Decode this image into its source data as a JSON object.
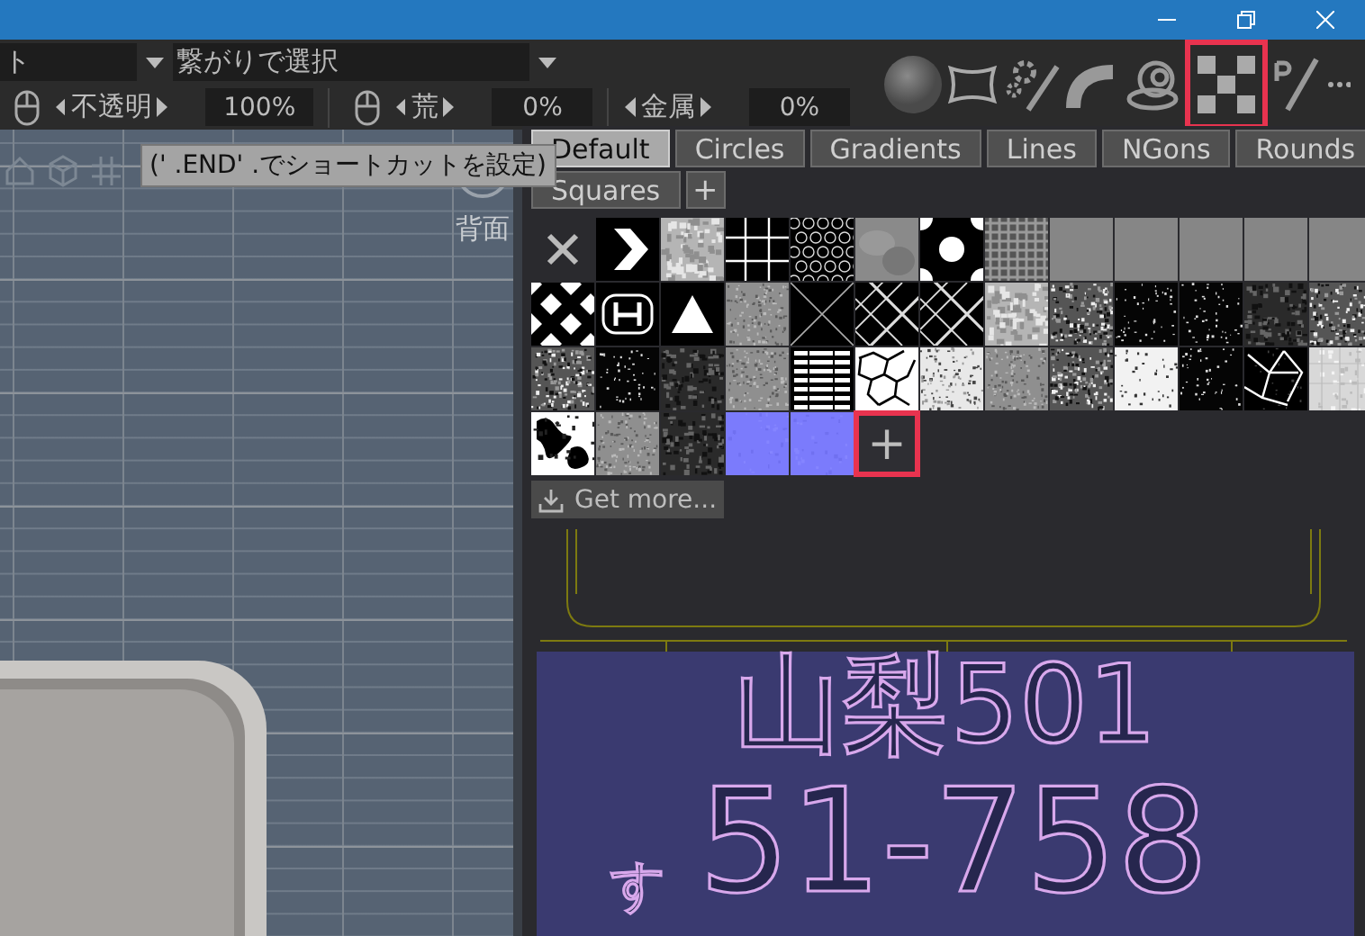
{
  "title_bar": {
    "buttons": [
      {
        "kind": "minimize"
      },
      {
        "kind": "restore"
      },
      {
        "kind": "close"
      }
    ]
  },
  "toolbar": {
    "mode_dropdown": {
      "value": "ト"
    },
    "select_dropdown": {
      "value": "繋がりで選択"
    },
    "params": [
      {
        "label": "不透明",
        "value": "100%",
        "mouse": true
      },
      {
        "label": "荒",
        "value": "0%",
        "mouse": true
      },
      {
        "label": "金属",
        "value": "0%",
        "mouse": false
      }
    ],
    "tools": [
      {
        "kind": "sphere",
        "highlighted": false
      },
      {
        "kind": "warp",
        "highlighted": false
      },
      {
        "kind": "gears",
        "highlighted": false
      },
      {
        "kind": "pipe",
        "highlighted": false
      },
      {
        "kind": "spiral",
        "highlighted": false
      },
      {
        "kind": "checker",
        "highlighted": true
      },
      {
        "kind": "brush",
        "highlighted": false
      },
      {
        "kind": "more",
        "highlighted": false
      }
    ]
  },
  "tooltip": {
    "text": "(' .END' .でショートカットを設定)"
  },
  "viewport": {
    "view_label": "背面"
  },
  "texture_panel": {
    "tabs": [
      {
        "label": "Default",
        "selected": true
      },
      {
        "label": "Circles",
        "selected": false
      },
      {
        "label": "Gradients",
        "selected": false
      },
      {
        "label": "Lines",
        "selected": false
      },
      {
        "label": "NGons",
        "selected": false
      },
      {
        "label": "Rounds",
        "selected": false
      },
      {
        "label": "Squares",
        "selected": false
      }
    ],
    "add_tab": "+",
    "textures": [
      {
        "kind": "none"
      },
      {
        "kind": "chevron"
      },
      {
        "kind": "mottled"
      },
      {
        "kind": "grid"
      },
      {
        "kind": "hex"
      },
      {
        "kind": "cloud"
      },
      {
        "kind": "dots"
      },
      {
        "kind": "plaid"
      },
      {
        "kind": "flat"
      },
      {
        "kind": "flat"
      },
      {
        "kind": "flat"
      },
      {
        "kind": "flat"
      },
      {
        "kind": "flat"
      },
      {
        "kind": "diamonds"
      },
      {
        "kind": "emblem"
      },
      {
        "kind": "triangle"
      },
      {
        "kind": "grain"
      },
      {
        "kind": "cross"
      },
      {
        "kind": "lattice"
      },
      {
        "kind": "lattice"
      },
      {
        "kind": "mottled"
      },
      {
        "kind": "noise"
      },
      {
        "kind": "speckle-dark"
      },
      {
        "kind": "speckle-dark"
      },
      {
        "kind": "noise-dark"
      },
      {
        "kind": "noise"
      },
      {
        "kind": "noise"
      },
      {
        "kind": "speckle-dark"
      },
      {
        "kind": "noise-dark"
      },
      {
        "kind": "grain"
      },
      {
        "kind": "bars"
      },
      {
        "kind": "cells"
      },
      {
        "kind": "noise-light"
      },
      {
        "kind": "grain"
      },
      {
        "kind": "noise"
      },
      {
        "kind": "speckle-light"
      },
      {
        "kind": "speckle-dark"
      },
      {
        "kind": "web"
      },
      {
        "kind": "grid-light"
      },
      {
        "kind": "blotch"
      },
      {
        "kind": "grain"
      },
      {
        "kind": "noise-dark"
      },
      {
        "kind": "normal"
      },
      {
        "kind": "normal"
      }
    ],
    "add_texture": {
      "label": "+",
      "highlighted": true
    },
    "get_more": "Get more..."
  },
  "plate": {
    "region": "山梨501",
    "kana": "す",
    "number": "51-758"
  }
}
